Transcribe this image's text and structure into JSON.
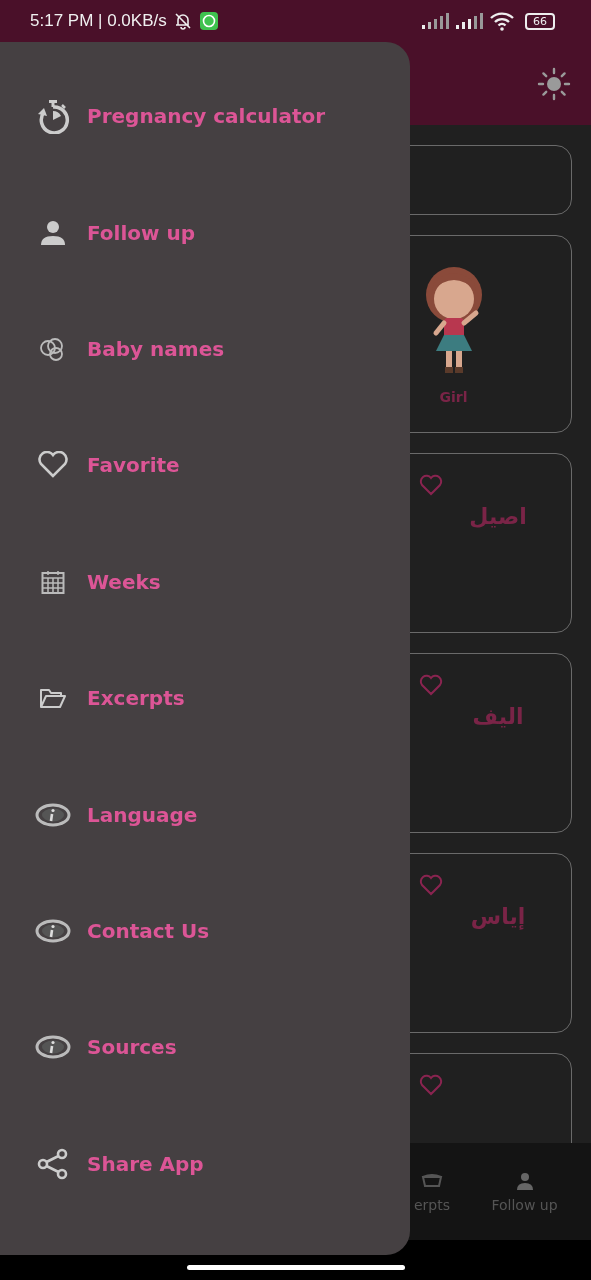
{
  "status_bar": {
    "time": "5:17 PM | 0.0KB/s",
    "battery": "66"
  },
  "drawer": {
    "items": [
      {
        "label": "Pregnancy calculator",
        "kind": "timer"
      },
      {
        "label": "Follow up",
        "kind": "person"
      },
      {
        "label": "Baby names",
        "kind": "rings"
      },
      {
        "label": "Favorite",
        "kind": "heart"
      },
      {
        "label": "Weeks",
        "kind": "calendar"
      },
      {
        "label": "Excerpts",
        "kind": "folder"
      },
      {
        "label": "Language",
        "kind": "info"
      },
      {
        "label": "Contact Us",
        "kind": "info"
      },
      {
        "label": "Sources",
        "kind": "info"
      },
      {
        "label": "Share App",
        "kind": "share"
      }
    ]
  },
  "content": {
    "girl_card": {
      "label": "Girl"
    },
    "name_cards": [
      {
        "name": "اصيل"
      },
      {
        "name": "اليف"
      },
      {
        "name": "إياس"
      }
    ]
  },
  "bottom_nav": [
    {
      "label": "erpts",
      "kind": "book"
    },
    {
      "label": "Follow up",
      "kind": "person"
    }
  ]
}
